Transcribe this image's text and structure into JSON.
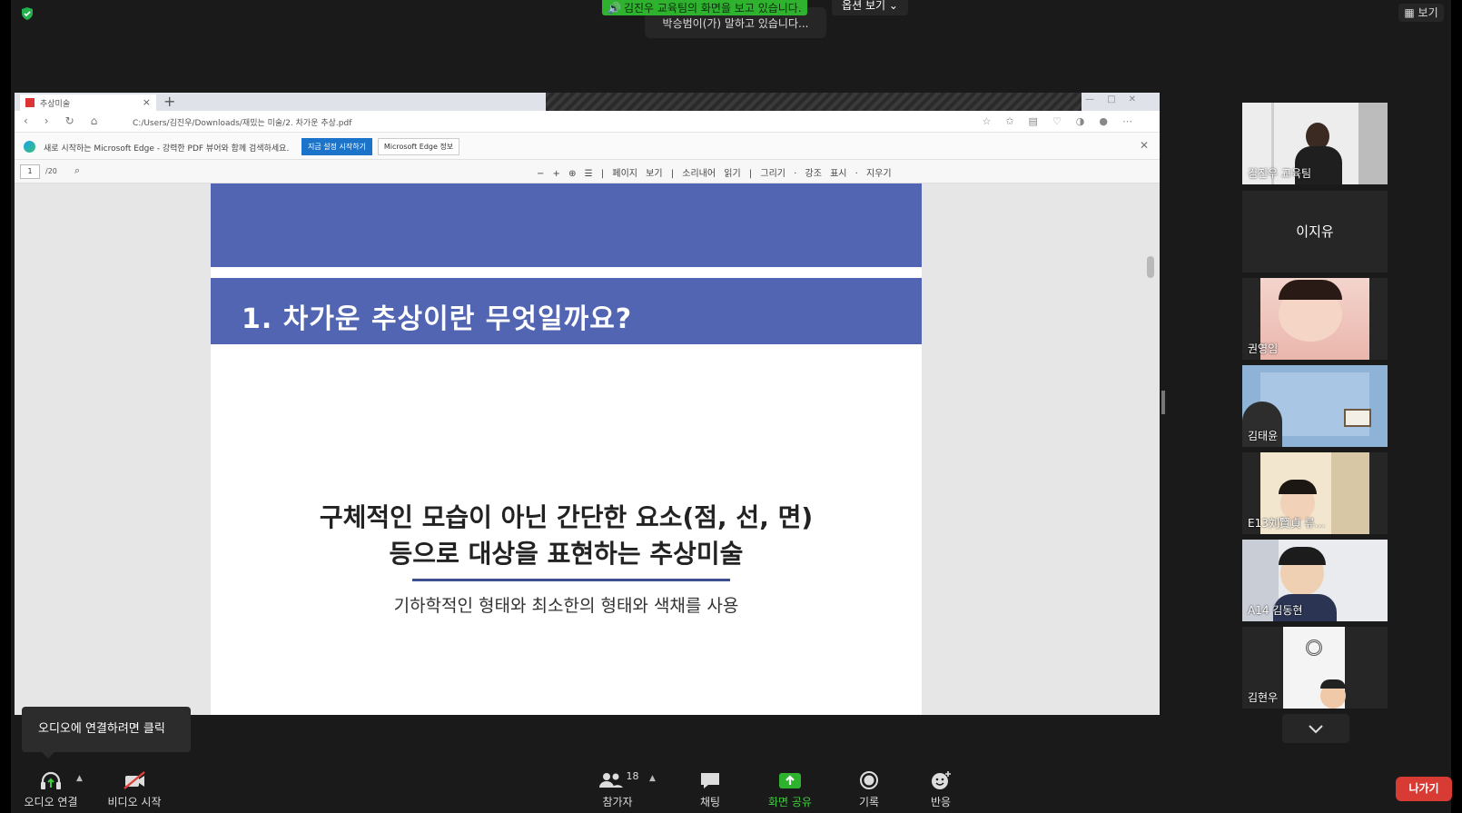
{
  "top": {
    "share_banner": "김진우 교육팀의 화면을 보고 있습니다.",
    "speaking": "박승범이(가) 말하고 있습니다...",
    "view_options": "옵션 보기",
    "layout_button": "보기"
  },
  "browser": {
    "tab_title": "추상미술",
    "url": "C:/Users/김진우/Downloads/재밌는 미술/2. 차가운 추상.pdf",
    "infobar_text": "새로 시작하는 Microsoft Edge - 강력한 PDF 뷰어와 함께 검색하세요.",
    "infobar_primary": "지금 설정 시작하기",
    "infobar_secondary": "Microsoft Edge 정보",
    "page_number": "1",
    "page_total": "/20",
    "pdf_tools": "−  +  ⊕  ☰  |  페이지 보기  |  소리내어 읽기  |  그리기  ·  강조 표시  ·  지우기"
  },
  "slide": {
    "title": "1. 차가운 추상이란 무엇일까요?",
    "headline_1": "구체적인 모습이 아닌 간단한 요소(점, 선, 면)",
    "headline_2": "등으로 대상을 표현하는 추상미술",
    "subline": "기하학적인 형태와 최소한의 형태와 색채를 사용"
  },
  "participants": [
    {
      "name": "김진우 교육팀"
    },
    {
      "name": "이지유"
    },
    {
      "name": "권영임"
    },
    {
      "name": "김태윤"
    },
    {
      "name": "E13刘賢貞 류..."
    },
    {
      "name": "A14 김동현"
    },
    {
      "name": "김현우"
    }
  ],
  "tooltip": "오디오에 연결하려면 클릭",
  "controls": {
    "audio": "오디오 연결",
    "video": "비디오 시작",
    "participants": "참가자",
    "participants_count": "18",
    "chat": "채팅",
    "share": "화면 공유",
    "record": "기록",
    "reactions": "반응",
    "leave": "나가기"
  },
  "colors": {
    "slide_blue": "#5265b3",
    "share_green": "#2fb32f",
    "leave_red": "#d83a34"
  }
}
